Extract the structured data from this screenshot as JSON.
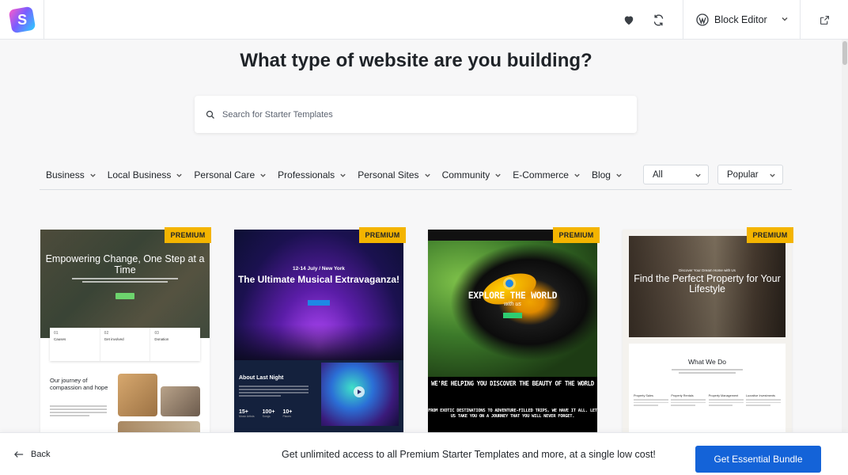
{
  "app": {
    "logo_letter": "S"
  },
  "header": {
    "favorites_icon": "heart-icon",
    "sync_icon": "sync-icon",
    "editor_label": "Block Editor",
    "external_icon": "external-link-icon"
  },
  "page": {
    "heading": "What type of website are you building?"
  },
  "search": {
    "placeholder": "Search for Starter Templates",
    "value": ""
  },
  "filters": {
    "categories": [
      {
        "label": "Business"
      },
      {
        "label": "Local Business"
      },
      {
        "label": "Personal Care"
      },
      {
        "label": "Professionals"
      },
      {
        "label": "Personal Sites"
      },
      {
        "label": "Community"
      },
      {
        "label": "E-Commerce"
      },
      {
        "label": "Blog"
      }
    ],
    "type_select": "All",
    "sort_select": "Popular"
  },
  "templates": [
    {
      "badge": "PREMIUM",
      "headline": "Empowering Change, One Step at a Time",
      "boxes": [
        {
          "num": "01",
          "title": "Causes"
        },
        {
          "num": "02",
          "title": "Get involved"
        },
        {
          "num": "03",
          "title": "Donation"
        }
      ],
      "section": "Our journey of compassion and hope"
    },
    {
      "badge": "PREMIUM",
      "date": "12-14 July / New York",
      "headline": "The Ultimate Musical Extravaganza!",
      "section": "About Last Night",
      "stats": [
        {
          "value": "15+",
          "label": "Music Artists"
        },
        {
          "value": "100+",
          "label": "Songs"
        },
        {
          "value": "10+",
          "label": "Places"
        }
      ]
    },
    {
      "badge": "PREMIUM",
      "headline": "EXPLORE THE WORLD",
      "script": "with us",
      "tagline": "WE'RE HELPING YOU DISCOVER THE BEAUTY OF THE WORLD",
      "subtag": "FROM EXOTIC DESTINATIONS TO ADVENTURE-FILLED TRIPS, WE HAVE IT ALL. LET US TAKE YOU ON A JOURNEY THAT YOU WILL NEVER FORGET."
    },
    {
      "badge": "PREMIUM",
      "kicker": "Discover Your Dream Home with Us",
      "headline": "Find the Perfect Property for Your Lifestyle",
      "section": "What We Do",
      "columns": [
        "Property Sales",
        "Property Rentals",
        "Property Management",
        "Lucrative Investments"
      ]
    }
  ],
  "footer": {
    "back_label": "Back",
    "promo_text": "Get unlimited access to all Premium Starter Templates and more, at a single low cost!",
    "cta_label": "Get Essential Bundle"
  },
  "colors": {
    "accent": "#1463d8",
    "badge": "#f4b400",
    "background": "#f7f7f8"
  }
}
